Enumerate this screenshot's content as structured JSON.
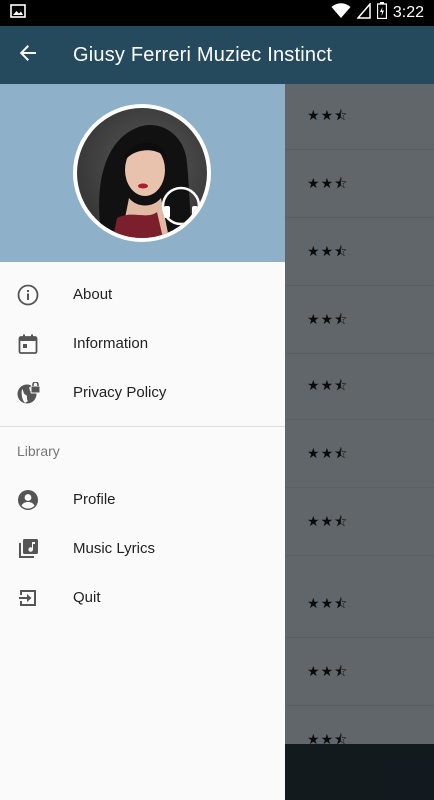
{
  "status_bar": {
    "time": "3:22",
    "icons": [
      "image-icon",
      "wifi-icon",
      "signal-icon",
      "battery-icon"
    ]
  },
  "app_bar": {
    "title": "Giusy Ferreri Muziec Instinct",
    "back_icon": "arrow-back-icon",
    "background": "#254a5e"
  },
  "drawer": {
    "header_color": "#8fb0c9",
    "avatar_alt": "profile-photo",
    "menu": [
      {
        "label": "About",
        "icon": "info-icon"
      },
      {
        "label": "Information",
        "icon": "calendar-icon"
      },
      {
        "label": "Privacy Policy",
        "icon": "globe-lock-icon"
      }
    ],
    "library_section": "Library",
    "library_menu": [
      {
        "label": "Profile",
        "icon": "account-circle-icon"
      },
      {
        "label": "Music Lyrics",
        "icon": "music-library-icon"
      },
      {
        "label": "Quit",
        "icon": "exit-icon"
      }
    ]
  },
  "content": {
    "rows": [
      {
        "rating": "2.5"
      },
      {
        "rating": "2.5"
      },
      {
        "rating": "2.5"
      },
      {
        "rating": "2.5"
      },
      {
        "rating": "2.5"
      },
      {
        "rating": "2.5"
      },
      {
        "rating": "2.5"
      },
      {
        "rating": "2.5"
      },
      {
        "rating": "2.5"
      },
      {
        "rating": "2.5"
      }
    ],
    "star_glyphs": {
      "full": "★",
      "half": "⯪"
    }
  }
}
